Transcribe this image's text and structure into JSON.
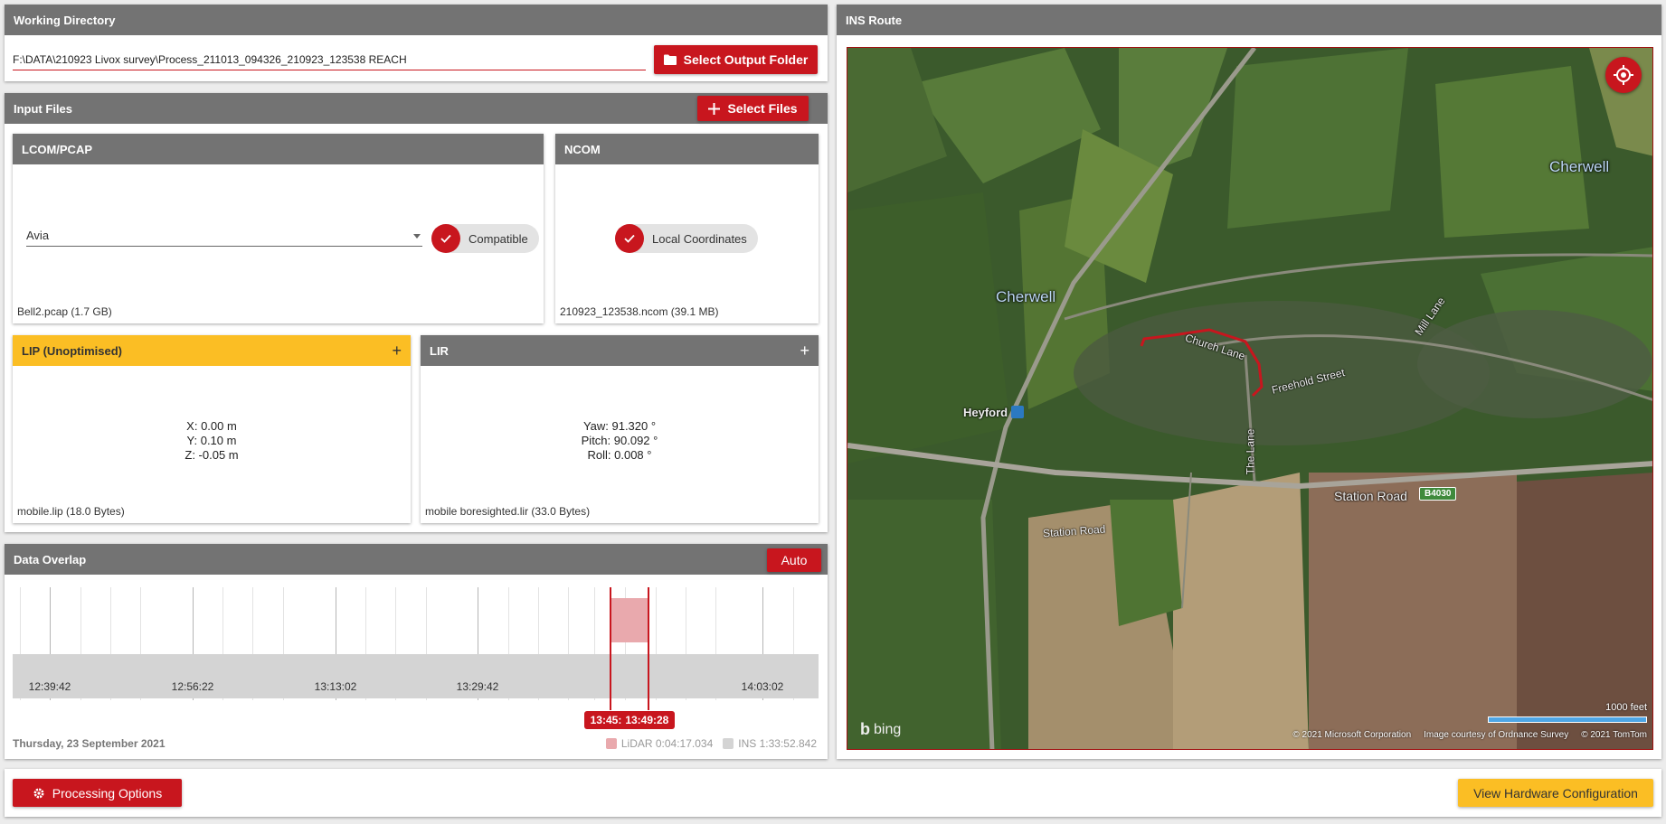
{
  "working_directory": {
    "title": "Working Directory",
    "path": "F:\\DATA\\210923 Livox survey\\Process_211013_094326_210923_123538 REACH",
    "select_output_label": "Select Output Folder"
  },
  "input_files": {
    "title": "Input Files",
    "select_files_label": "Select Files",
    "lcom": {
      "title": "LCOM/PCAP",
      "sensor_selected": "Avia",
      "status": "Compatible",
      "file": "Bell2.pcap (1.7 GB)"
    },
    "ncom": {
      "title": "NCOM",
      "status": "Local Coordinates",
      "file": "210923_123538.ncom (39.1 MB)"
    },
    "lip": {
      "title": "LIP (Unoptimised)",
      "add_label": "+",
      "x": "X: 0.00 m",
      "y": "Y: 0.10 m",
      "z": "Z: -0.05 m",
      "file": "mobile.lip (18.0 Bytes)"
    },
    "lir": {
      "title": "LIR",
      "add_label": "+",
      "yaw": "Yaw: 91.320 °",
      "pitch": "Pitch: 90.092 °",
      "roll": "Roll: 0.008 °",
      "file": "mobile boresighted.lir (33.0 Bytes)"
    }
  },
  "data_overlap": {
    "title": "Data Overlap",
    "auto_label": "Auto",
    "ticks": [
      "12:39:42",
      "12:56:22",
      "13:13:02",
      "13:29:42",
      "14:03:02"
    ],
    "selection_start": "13:45:",
    "selection_end": "13:49:28",
    "date": "Thursday, 23 September 2021",
    "lidar_legend": "LiDAR 0:04:17.034",
    "ins_legend": "INS 1:33:52.842",
    "lidar_color": "#e9a9ad",
    "ins_color": "#d4d4d4"
  },
  "ins_route": {
    "title": "INS Route",
    "places": [
      "Cherwell",
      "Cherwell",
      "Heyford"
    ],
    "roads": [
      "Church Lane",
      "Freehold Street",
      "Mill Lane",
      "The Lane",
      "Station Road",
      "Station Road"
    ],
    "road_badge": "B4030",
    "scale_label": "1000 feet",
    "brand": "bing",
    "copyright": [
      "© 2021 Microsoft Corporation",
      "Image courtesy of Ordnance Survey",
      "© 2021 TomTom"
    ]
  },
  "footer": {
    "processing_label": "Processing Options",
    "hardware_label": "View Hardware Configuration"
  },
  "colors": {
    "accent_red": "#c8161e",
    "accent_yellow": "#fbbe24",
    "header_gray": "#737373"
  }
}
